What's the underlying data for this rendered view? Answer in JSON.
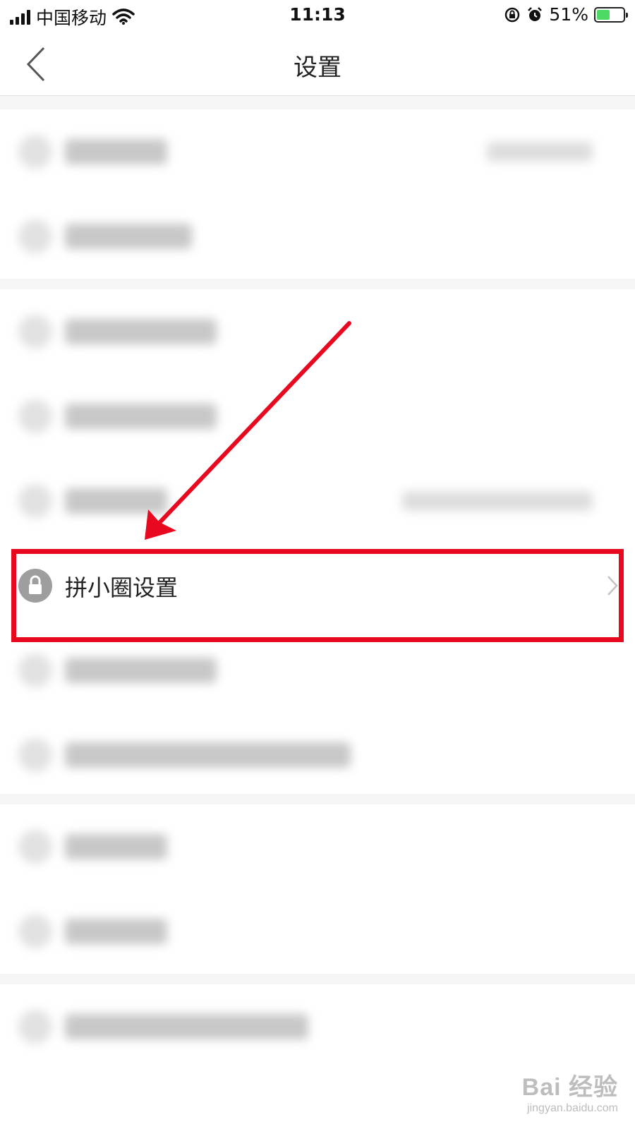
{
  "status_bar": {
    "carrier": "中国移动",
    "time": "11:13",
    "battery_percent": "51%",
    "battery_level": 0.51,
    "icons": [
      "signal-icon",
      "wifi-icon",
      "orientation-lock-icon",
      "alarm-icon",
      "battery-charging-icon"
    ]
  },
  "nav": {
    "title": "设置",
    "back_icon": "chevron-left-icon"
  },
  "settings": {
    "highlighted_item": {
      "label": "拼小圈设置",
      "icon": "lock-icon",
      "chevron_icon": "chevron-right-icon"
    }
  },
  "annotation": {
    "highlight_color": "#e8081f"
  },
  "watermark": {
    "logo": "Bai 经验",
    "url": "jingyan.baidu.com"
  }
}
